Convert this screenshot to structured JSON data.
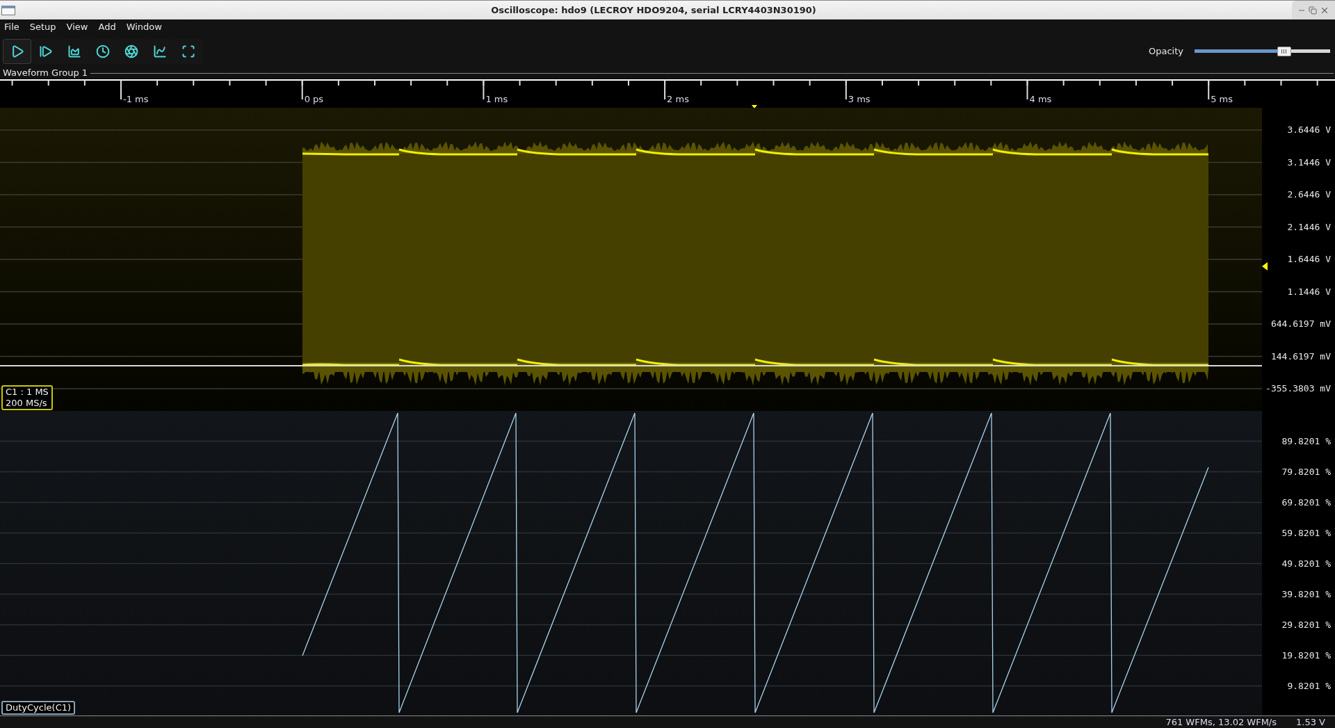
{
  "window": {
    "title": "Oscilloscope: hdo9 (LECROY HDO9204, serial LCRY4403N30190)"
  },
  "menu": [
    "File",
    "Setup",
    "View",
    "Add",
    "Window"
  ],
  "toolbar": [
    {
      "kind": "run",
      "selected": true
    },
    {
      "kind": "step",
      "selected": false
    },
    {
      "kind": "waveform",
      "selected": false
    },
    {
      "kind": "history",
      "selected": false
    },
    {
      "kind": "settings",
      "selected": false
    },
    {
      "kind": "measure",
      "selected": false
    },
    {
      "kind": "fit",
      "selected": false
    }
  ],
  "opacity": {
    "label": "Opacity",
    "level": 0.66
  },
  "waveform_group": {
    "title": "Waveform Group 1",
    "time_ticks": [
      "-1 ms",
      "0 ps",
      "1 ms",
      "2 ms",
      "3 ms",
      "4 ms",
      "5 ms"
    ],
    "panels": [
      {
        "kind": "analog",
        "color": "#c8c800",
        "channel_label": [
          "C1 : 1 MS",
          "200 MS/s"
        ],
        "axis_labels": [
          "3.6446 V",
          "3.1446 V",
          "2.6446 V",
          "2.1446 V",
          "1.6446 V",
          "1.1446 V",
          "644.6197 mV",
          "144.6197 mV",
          "-355.3803 mV"
        ]
      },
      {
        "kind": "duty_cycle",
        "color": "#8aa4b8",
        "channel_label": [
          "DutyCycle(C1)"
        ],
        "axis_labels": [
          "89.8201 %",
          "79.8201 %",
          "69.8201 %",
          "59.8201 %",
          "49.8201 %",
          "39.8201 %",
          "29.8201 %",
          "19.8201 %",
          "9.8201 %"
        ]
      }
    ]
  },
  "status_bar": {
    "stats": "761 WFMs, 13.02 WFM/s",
    "reading": "1.53 V"
  }
}
